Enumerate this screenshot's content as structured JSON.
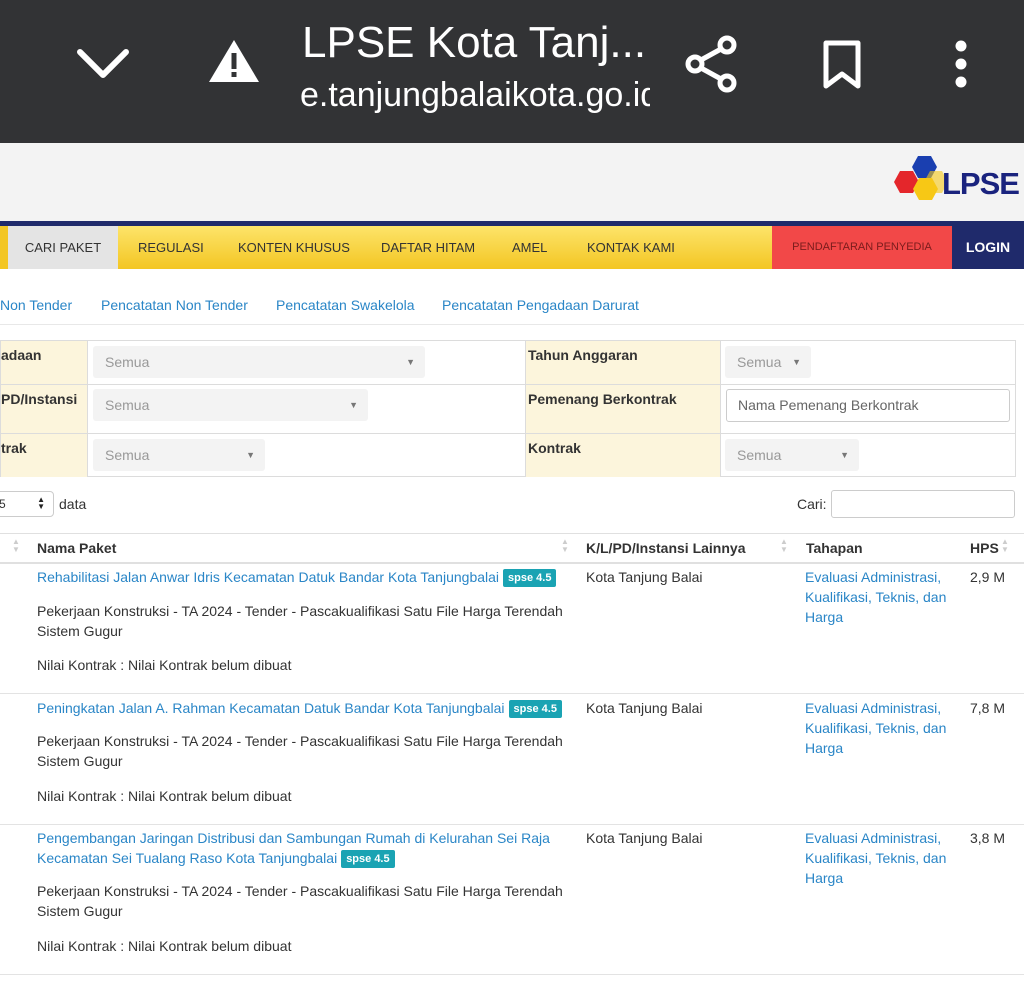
{
  "browser": {
    "title": "LPSE Kota Tanj...",
    "url": "e.tanjungbalaikota.go.id"
  },
  "logo": {
    "text": "LPSE"
  },
  "nav": {
    "items": [
      "CARI PAKET",
      "REGULASI",
      "KONTEN KHUSUS",
      "DAFTAR HITAM",
      "AMEL",
      "KONTAK KAMI"
    ],
    "register": "PENDAFTARAN PENYEDIA",
    "login": "LOGIN"
  },
  "subtabs": [
    "Non Tender",
    "Pencatatan Non Tender",
    "Pencatatan Swakelola",
    "Pencatatan Pengadaan Darurat"
  ],
  "filters": {
    "row1_left_label": "adaan",
    "row1_left_value": "Semua",
    "row1_right_label": "Tahun Anggaran",
    "row1_right_value": "Semua",
    "row2_left_label": "PD/Instansi",
    "row2_left_value": "Semua",
    "row2_right_label": "Pemenang Berkontrak",
    "row2_right_placeholder": "Nama Pemenang Berkontrak",
    "row3_left_label": "trak",
    "row3_left_value": "Semua",
    "row3_right_label": "Kontrak",
    "row3_right_value": "Semua"
  },
  "table_controls": {
    "length_value": "5",
    "length_suffix": "data",
    "search_label": "Cari:"
  },
  "table": {
    "headers": {
      "nama": "Nama Paket",
      "instansi": "K/L/PD/Instansi Lainnya",
      "tahapan": "Tahapan",
      "hps": "HPS"
    },
    "rows": [
      {
        "title": "Rehabilitasi Jalan Anwar Idris Kecamatan Datuk Bandar Kota Tanjungbalai",
        "badge": "spse 4.5",
        "desc": "Pekerjaan Konstruksi - TA 2024 - Tender - Pascakualifikasi Satu File Harga Terendah Sistem Gugur",
        "nilai": "Nilai Kontrak : Nilai Kontrak belum dibuat",
        "instansi": "Kota Tanjung Balai",
        "tahapan": "Evaluasi Administrasi, Kualifikasi, Teknis, dan Harga",
        "hps": "2,9 M"
      },
      {
        "title": "Peningkatan Jalan A. Rahman Kecamatan Datuk Bandar Kota Tanjungbalai",
        "badge": "spse 4.5",
        "desc": "Pekerjaan Konstruksi - TA 2024 - Tender - Pascakualifikasi Satu File Harga Terendah Sistem Gugur",
        "nilai": "Nilai Kontrak : Nilai Kontrak belum dibuat",
        "instansi": "Kota Tanjung Balai",
        "tahapan": "Evaluasi Administrasi, Kualifikasi, Teknis, dan Harga",
        "hps": "7,8 M"
      },
      {
        "title": "Pengembangan Jaringan Distribusi dan Sambungan Rumah di Kelurahan Sei Raja Kecamatan Sei Tualang Raso Kota Tanjungbalai",
        "badge": "spse 4.5",
        "desc": "Pekerjaan Konstruksi - TA 2024 - Tender - Pascakualifikasi Satu File Harga Terendah Sistem Gugur",
        "nilai": "Nilai Kontrak : Nilai Kontrak belum dibuat",
        "instansi": "Kota Tanjung Balai",
        "tahapan": "Evaluasi Administrasi, Kualifikasi, Teknis, dan Harga",
        "hps": "3,8 M"
      }
    ]
  },
  "colors": {
    "browser_bar": "#323335",
    "nav_yellow": "#f9d74a",
    "nav_red": "#f24848",
    "nav_navy": "#1f2a6b",
    "link_blue": "#2a86c7",
    "badge_teal": "#1aa3b3",
    "filter_label_bg": "#fcf5dc"
  }
}
